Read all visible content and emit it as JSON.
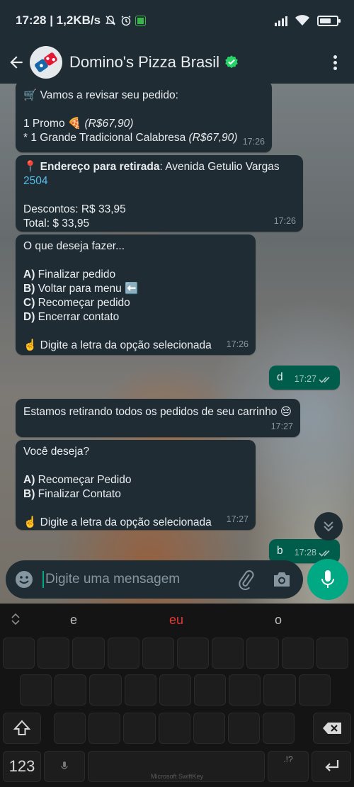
{
  "status_bar": {
    "time_speed": "17:28 | 1,2KB/s",
    "battery_level": 0.7
  },
  "header": {
    "contact_name": "Domino's Pizza Brasil",
    "verified": true,
    "icons": [
      "back-arrow-icon",
      "dominos-logo",
      "verified-icon",
      "more-options-icon"
    ]
  },
  "messages": [
    {
      "direction": "in",
      "lines": [
        {
          "emoji": "🛒",
          "text": " Vamos a revisar seu pedido:"
        },
        {
          "text": ""
        },
        {
          "text": "1 Promo ",
          "emoji_after": "🍕",
          "italic": " (R$67,90)"
        },
        {
          "text": " * 1 Grande Tradicional Calabresa ",
          "italic": "(R$67,90)"
        }
      ],
      "time": "17:26"
    },
    {
      "direction": "in",
      "lines": [
        {
          "emoji": "📍",
          "bold": " Endereço para retirada",
          "text": ": Avenida Getulio Vargas"
        },
        {
          "link": "2504"
        },
        {
          "text": ""
        },
        {
          "text": "Descontos: R$ 33,95"
        },
        {
          "text": "Total: $ 33,95"
        }
      ],
      "time": "17:26"
    },
    {
      "direction": "in",
      "lines": [
        {
          "text": "O que deseja fazer..."
        },
        {
          "text": ""
        },
        {
          "bold": "A)",
          "text": " Finalizar pedido"
        },
        {
          "bold": "B)",
          "text": " Voltar para menu ",
          "emoji_after": "⬅️"
        },
        {
          "bold": "C)",
          "text": " Recomeçar pedido"
        },
        {
          "bold": "D)",
          "text": " Encerrar contato"
        },
        {
          "text": ""
        },
        {
          "emoji": "☝️",
          "text": "  Digite a letra da opção selecionada"
        }
      ],
      "time": "17:26"
    },
    {
      "direction": "out",
      "lines": [
        {
          "text": "d"
        }
      ],
      "time": "17:27"
    },
    {
      "direction": "in",
      "lines": [
        {
          "text": "Estamos retirando todos os pedidos de seu carrinho ",
          "emoji_after": "😔"
        }
      ],
      "time": "17:27"
    },
    {
      "direction": "in",
      "lines": [
        {
          "text": "Você deseja?"
        },
        {
          "text": ""
        },
        {
          "bold": "A)",
          "text": " Recomeçar Pedido"
        },
        {
          "bold": "B)",
          "text": " Finalizar Contato"
        },
        {
          "text": ""
        },
        {
          "emoji": "☝️",
          "text": "  Digite a letra da opção selecionada"
        }
      ],
      "time": "17:27"
    },
    {
      "direction": "out",
      "lines": [
        {
          "text": "b"
        }
      ],
      "time": "17:28"
    }
  ],
  "composer": {
    "placeholder": "Digite uma mensagem",
    "icons": [
      "emoji-icon",
      "attach-icon",
      "camera-icon",
      "mic-icon"
    ]
  },
  "keyboard": {
    "suggestions": [
      "e",
      "eu",
      "o"
    ],
    "highlight_color": "#e53935",
    "numbers_key": "123",
    "brand": "Microsoft SwiftKey",
    "punct_key": ".!?"
  },
  "colors": {
    "accent": "#00a884",
    "bubble_in": "#1f2c34",
    "bubble_out": "#005c4b",
    "header": "#1f2c34",
    "link": "#53bdeb"
  }
}
